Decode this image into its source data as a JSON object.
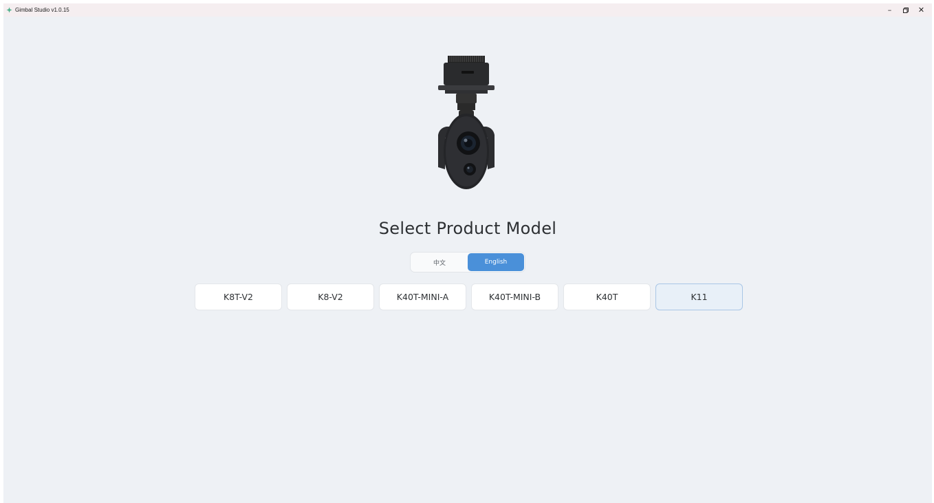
{
  "window": {
    "title": "Gimbal Studio v1.0.15",
    "controls": {
      "minimize": "–",
      "restore": "⧉",
      "close": "✕"
    }
  },
  "main": {
    "heading": "Select Product Model",
    "language": {
      "options": [
        "中文",
        "English"
      ],
      "selected": "English"
    },
    "models": [
      "K8T-V2",
      "K8-V2",
      "K40T-MINI-A",
      "K40T-MINI-B",
      "K40T",
      "K11"
    ],
    "selected_model": "K11"
  },
  "icons": {
    "app": "app-logo-icon",
    "product": "gimbal-camera-image"
  },
  "colors": {
    "background": "#eef1f5",
    "accent": "#4a90d9",
    "selected_model_bg": "#e8f0f8"
  }
}
